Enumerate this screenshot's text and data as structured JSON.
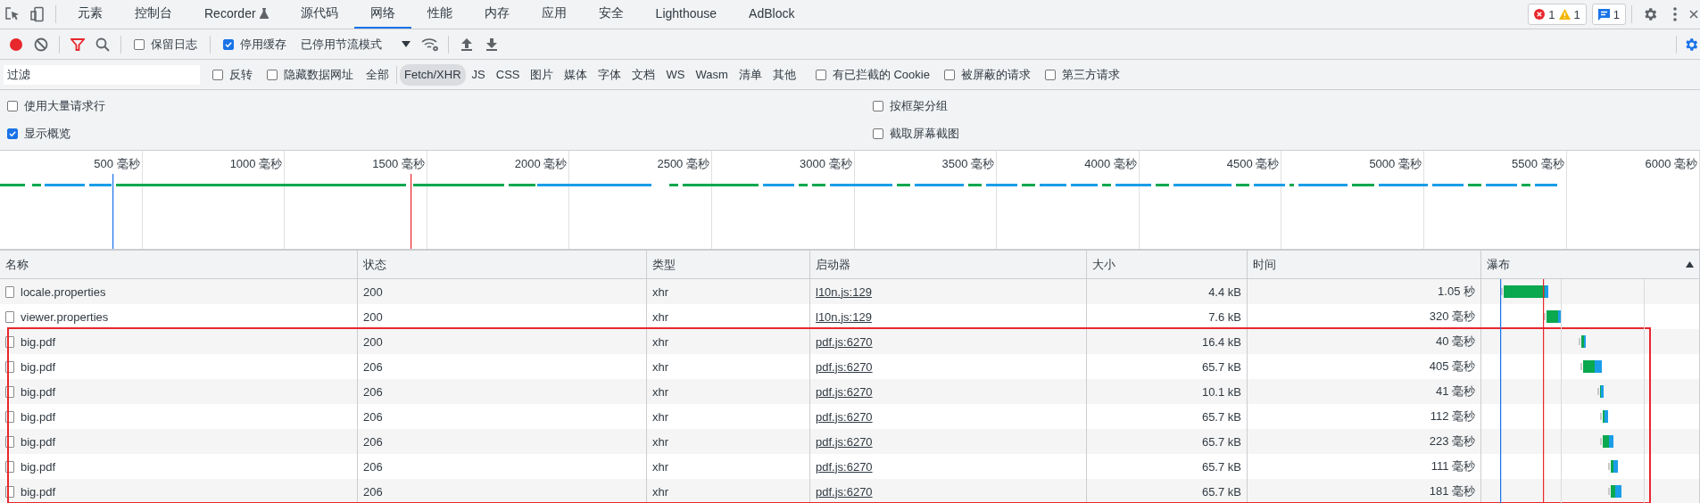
{
  "tabs": [
    {
      "label": "元素",
      "selected": false,
      "kind": "text"
    },
    {
      "label": "控制台",
      "selected": false,
      "kind": "text"
    },
    {
      "label": "Recorder",
      "selected": false,
      "kind": "flask"
    },
    {
      "label": "源代码",
      "selected": false,
      "kind": "text"
    },
    {
      "label": "网络",
      "selected": true,
      "kind": "text"
    },
    {
      "label": "性能",
      "selected": false,
      "kind": "text"
    },
    {
      "label": "内存",
      "selected": false,
      "kind": "text"
    },
    {
      "label": "应用",
      "selected": false,
      "kind": "text"
    },
    {
      "label": "安全",
      "selected": false,
      "kind": "text"
    },
    {
      "label": "Lighthouse",
      "selected": false,
      "kind": "text"
    },
    {
      "label": "AdBlock",
      "selected": false,
      "kind": "text"
    }
  ],
  "counters": {
    "errors": "1",
    "warnings": "1",
    "messages": "1"
  },
  "toolbar": {
    "recording": true,
    "filter_active": true,
    "checkboxes": [
      {
        "label": "保留日志",
        "checked": false
      },
      {
        "label": "停用缓存",
        "checked": true
      }
    ],
    "throttling": "已停用节流模式"
  },
  "filter": {
    "placeholder": "过滤",
    "checkboxes_before": [
      {
        "label": "反转",
        "checked": false
      },
      {
        "label": "隐藏数据网址",
        "checked": false
      }
    ],
    "types": [
      {
        "label": "全部",
        "selected": false
      },
      {
        "label": "Fetch/XHR",
        "selected": true
      },
      {
        "label": "JS",
        "selected": false
      },
      {
        "label": "CSS",
        "selected": false
      },
      {
        "label": "图片",
        "selected": false
      },
      {
        "label": "媒体",
        "selected": false
      },
      {
        "label": "字体",
        "selected": false
      },
      {
        "label": "文档",
        "selected": false
      },
      {
        "label": "WS",
        "selected": false
      },
      {
        "label": "Wasm",
        "selected": false
      },
      {
        "label": "清单",
        "selected": false
      },
      {
        "label": "其他",
        "selected": false
      }
    ],
    "checkboxes_after": [
      {
        "label": "有已拦截的 Cookie",
        "checked": false
      },
      {
        "label": "被屏蔽的请求",
        "checked": false
      },
      {
        "label": "第三方请求",
        "checked": false
      }
    ]
  },
  "options": {
    "left": [
      {
        "label": "使用大量请求行",
        "checked": false
      },
      {
        "label": "显示概览",
        "checked": true
      }
    ],
    "right": [
      {
        "label": "按框架分组",
        "checked": false
      },
      {
        "label": "截取屏幕截图",
        "checked": false
      }
    ]
  },
  "overview": {
    "ticks": [
      "500 毫秒",
      "1000 毫秒",
      "1500 毫秒",
      "2000 毫秒",
      "2500 毫秒",
      "3000 毫秒",
      "3500 毫秒",
      "4000 毫秒",
      "4500 毫秒",
      "5000 毫秒",
      "5500 毫秒",
      "6000 毫秒"
    ]
  },
  "table": {
    "columns": [
      "名称",
      "状态",
      "类型",
      "启动器",
      "大小",
      "时间",
      "瀑布"
    ],
    "rows": [
      {
        "name": "locale.properties",
        "status": "200",
        "type": "xhr",
        "initiator": "l10n.js:129",
        "size": "4.4 kB",
        "time": "1.05 秒",
        "highlighted": false
      },
      {
        "name": "viewer.properties",
        "status": "200",
        "type": "xhr",
        "initiator": "l10n.js:129",
        "size": "7.6 kB",
        "time": "320 毫秒",
        "highlighted": false
      },
      {
        "name": "big.pdf",
        "status": "200",
        "type": "xhr",
        "initiator": "pdf.js:6270",
        "size": "16.4 kB",
        "time": "40 毫秒",
        "highlighted": true
      },
      {
        "name": "big.pdf",
        "status": "206",
        "type": "xhr",
        "initiator": "pdf.js:6270",
        "size": "65.7 kB",
        "time": "405 毫秒",
        "highlighted": true
      },
      {
        "name": "big.pdf",
        "status": "206",
        "type": "xhr",
        "initiator": "pdf.js:6270",
        "size": "10.1 kB",
        "time": "41 毫秒",
        "highlighted": true
      },
      {
        "name": "big.pdf",
        "status": "206",
        "type": "xhr",
        "initiator": "pdf.js:6270",
        "size": "65.7 kB",
        "time": "112 毫秒",
        "highlighted": true
      },
      {
        "name": "big.pdf",
        "status": "206",
        "type": "xhr",
        "initiator": "pdf.js:6270",
        "size": "65.7 kB",
        "time": "223 毫秒",
        "highlighted": true
      },
      {
        "name": "big.pdf",
        "status": "206",
        "type": "xhr",
        "initiator": "pdf.js:6270",
        "size": "65.7 kB",
        "time": "111 毫秒",
        "highlighted": true
      },
      {
        "name": "big.pdf",
        "status": "206",
        "type": "xhr",
        "initiator": "pdf.js:6270",
        "size": "65.7 kB",
        "time": "181 毫秒",
        "highlighted": true
      }
    ]
  }
}
